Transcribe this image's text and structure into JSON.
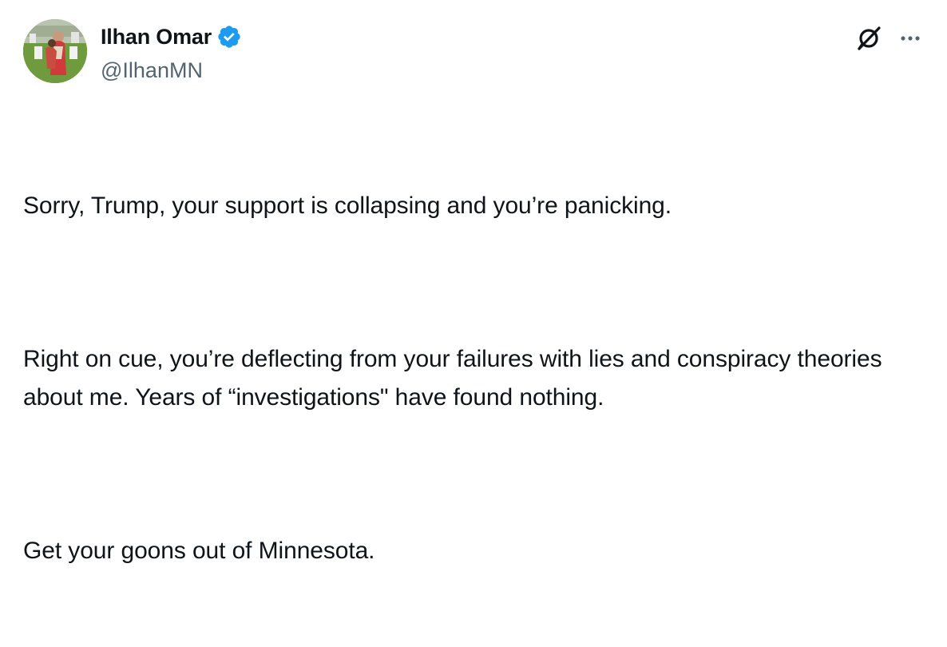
{
  "author": {
    "display_name": "Ilhan Omar",
    "handle": "@IlhanMN",
    "verified": true,
    "avatar": "profile-photo"
  },
  "colors": {
    "text": "#0f1419",
    "secondary_text": "#536471",
    "verified_badge": "#1d9bf0"
  },
  "actions": {
    "grok_icon": "grok-icon",
    "more_icon": "more-options-icon"
  },
  "tweet": {
    "paragraphs": [
      "Sorry, Trump, your support is collapsing and you’re panicking.",
      "Right on cue, you’re deflecting from your failures with lies and conspiracy theories about me. Years of “investigations\" have found nothing.",
      "Get your goons out of Minnesota."
    ]
  }
}
